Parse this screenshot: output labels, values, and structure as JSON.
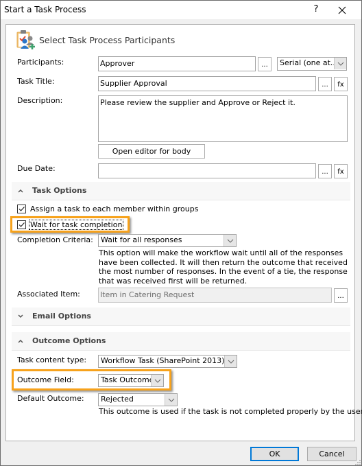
{
  "window": {
    "title": "Start a Task Process",
    "help_label": "?",
    "close_icon": "close-icon"
  },
  "header": {
    "icon": "task-participants-icon",
    "title": "Select Task Process Participants"
  },
  "form": {
    "participants": {
      "label": "Participants:",
      "value": "Approver",
      "browse_label": "...",
      "mode_value": "Serial (one at..."
    },
    "task_title": {
      "label": "Task Title:",
      "value": "Supplier Approval",
      "browse_label": "...",
      "fx_label": "fx"
    },
    "description": {
      "label": "Description:",
      "value": "Please review the supplier and Approve or Reject it.",
      "editor_button": "Open editor for body"
    },
    "due_date": {
      "label": "Due Date:",
      "value": "",
      "browse_label": "...",
      "fx_label": "fx"
    }
  },
  "task_options": {
    "title": "Task Options",
    "expanded": true,
    "assign_each_member": {
      "label": "Assign a task to each member within groups",
      "checked": true
    },
    "wait_for_completion": {
      "label": "Wait for task completion",
      "checked": true
    },
    "completion_criteria": {
      "label": "Completion Criteria:",
      "value": "Wait for all responses",
      "help": "This option will make the workflow wait until all of the responses have been collected. It will then return the outcome that received the most number of responses. In the event of a tie, the response that was received first will be returned."
    },
    "associated_item": {
      "label": "Associated Item:",
      "value": "Item in Catering Request",
      "browse_label": "..."
    }
  },
  "email_options": {
    "title": "Email Options",
    "expanded": false
  },
  "outcome_options": {
    "title": "Outcome Options",
    "expanded": true,
    "task_content_type": {
      "label": "Task content type:",
      "value": "Workflow Task (SharePoint 2013)"
    },
    "outcome_field": {
      "label": "Outcome Field:",
      "value": "Task Outcome"
    },
    "default_outcome": {
      "label": "Default Outcome:",
      "value": "Rejected",
      "help": "This outcome is used if the task is not completed properly by the user."
    }
  },
  "footer": {
    "ok_label": "OK",
    "cancel_label": "Cancel"
  },
  "colors": {
    "highlight": "#f7a21b",
    "primary_button_border": "#0078d7"
  }
}
